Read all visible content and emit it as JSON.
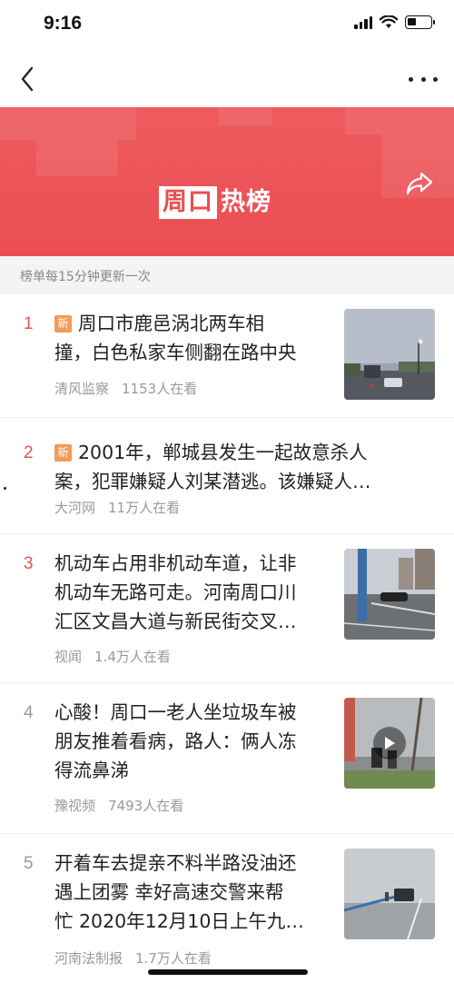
{
  "status_bar": {
    "time": "9:16"
  },
  "banner": {
    "logo_box_text": "周口",
    "logo_text": "热榜",
    "color": "#ea4e53"
  },
  "update_note": "榜单每15分钟更新一次",
  "new_tag": "新",
  "items": [
    {
      "rank": "1",
      "is_new": true,
      "title_line1": "周口市鹿邑涡北两车相",
      "title_line2": "撞，白色私家车侧翻在路中央",
      "title_line3": "",
      "source": "清风监察",
      "views": "1153人在看",
      "thumb": "car-crash-photo"
    },
    {
      "rank": "2",
      "is_new": true,
      "title_line1": "2001年，郸城县发生一起故意杀人",
      "title_line2": "案，犯罪嫌疑人刘某潜逃。该嫌疑人…",
      "title_line3": "",
      "source": "大河网",
      "views": "11万人在看",
      "thumb": ""
    },
    {
      "rank": "3",
      "is_new": false,
      "title_line1": "机动车占用非机动车道，让非",
      "title_line2": "机动车无路可走。河南周口川",
      "title_line3": "汇区文昌大道与新民街交叉…",
      "source": "视闻",
      "views": "1.4万人在看",
      "thumb": "street-photo"
    },
    {
      "rank": "4",
      "is_new": false,
      "title_line1": "心酸！周口一老人坐垃圾车被",
      "title_line2": "朋友推着看病，路人：俩人冻",
      "title_line3": "得流鼻涕",
      "source": "豫视频",
      "views": "7493人在看",
      "thumb": "video-thumbnail"
    },
    {
      "rank": "5",
      "is_new": false,
      "title_line1": "开着车去提亲不料半路没油还",
      "title_line2": "遇上团雾 幸好高速交警来帮",
      "title_line3": "忙 2020年12月10日上午九…",
      "source": "河南法制报",
      "views": "1.7万人在看",
      "thumb": "foggy-highway-photo"
    }
  ],
  "colors": {
    "accent": "#ea4e53",
    "new_tag": "#f29b58",
    "rank_normal": "#999999"
  }
}
